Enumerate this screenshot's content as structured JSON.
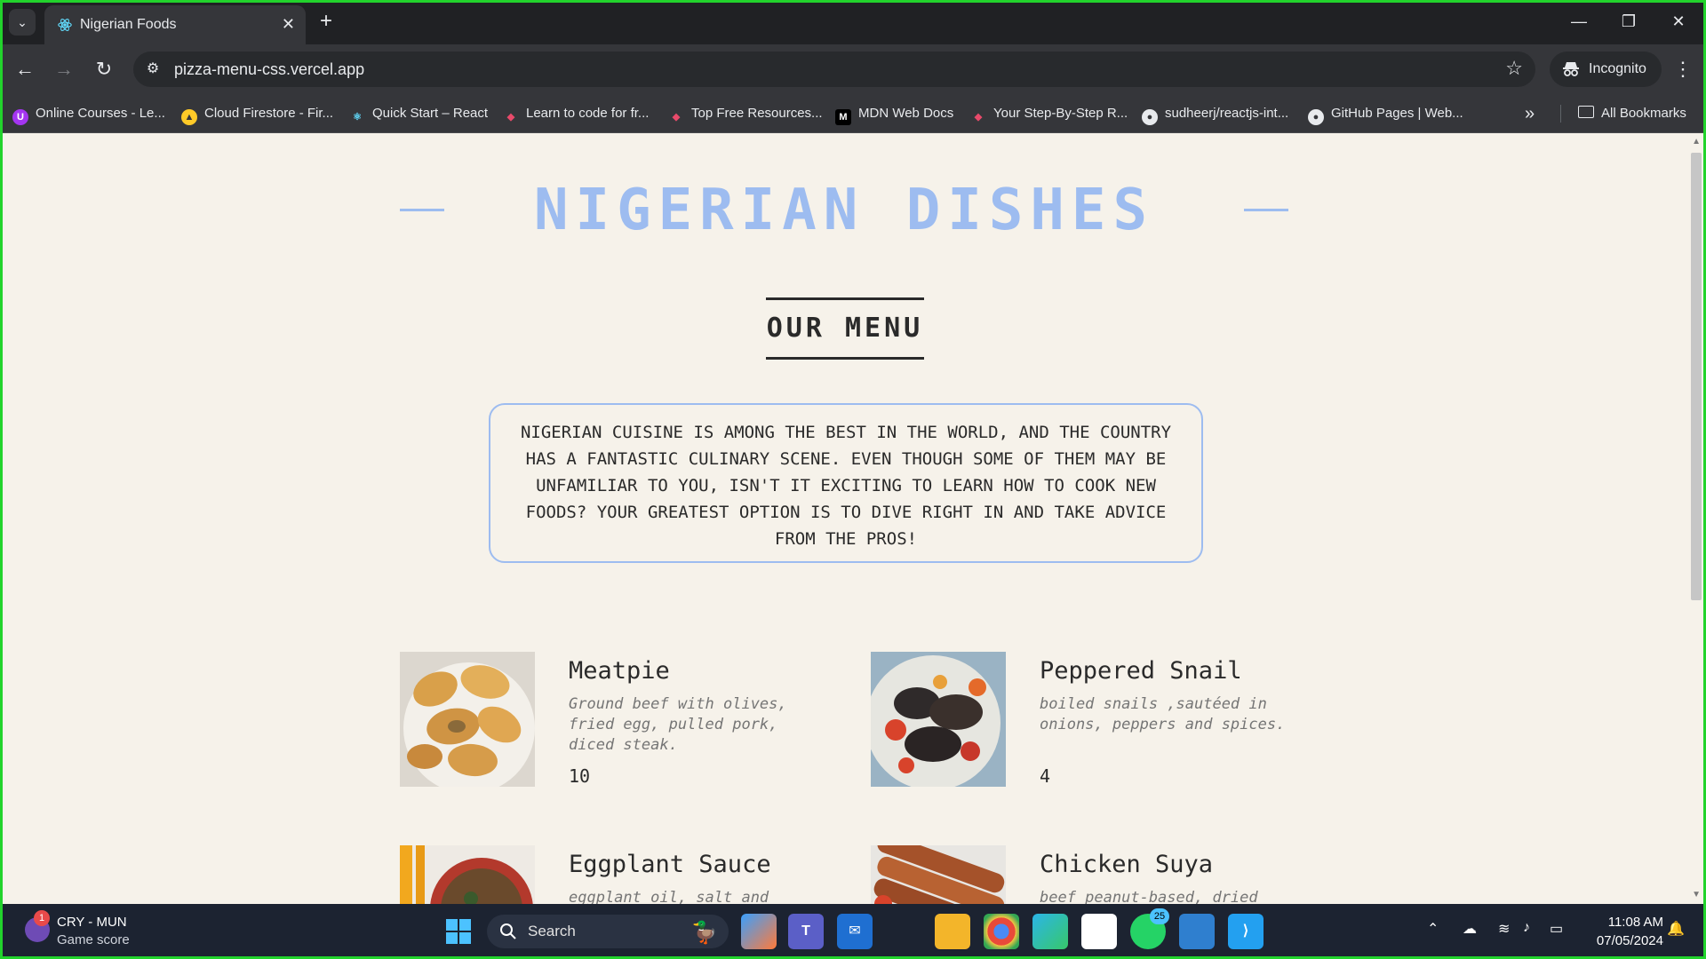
{
  "browser": {
    "tab_title": "Nigerian Foods",
    "url": "pizza-menu-css.vercel.app",
    "incognito_label": "Incognito"
  },
  "bookmarks": [
    {
      "label": "Online Courses - Le...",
      "icon": "udemy-icon",
      "color": "#a435f0"
    },
    {
      "label": "Cloud Firestore - Fir...",
      "icon": "firebase-icon",
      "color": "#ffca28"
    },
    {
      "label": "Quick Start – React",
      "icon": "react-icon",
      "color": "#61dafb"
    },
    {
      "label": "Learn to code for fr...",
      "icon": "scrimba-icon",
      "color": "#e84a6a"
    },
    {
      "label": "Top Free Resources...",
      "icon": "scrimba-icon",
      "color": "#e84a6a"
    },
    {
      "label": "MDN Web Docs",
      "icon": "mdn-icon",
      "color": "#ffffff"
    },
    {
      "label": "Your Step-By-Step R...",
      "icon": "scrimba-icon",
      "color": "#e84a6a"
    },
    {
      "label": "sudheerj/reactjs-int...",
      "icon": "github-icon",
      "color": "#ffffff"
    },
    {
      "label": "GitHub Pages | Web...",
      "icon": "github-icon",
      "color": "#ffffff"
    }
  ],
  "all_bookmarks_label": "All Bookmarks",
  "page": {
    "title": "NIGERIAN DISHES",
    "menu_heading": "OUR MENU",
    "intro": "NIGERIAN CUISINE IS AMONG THE BEST IN THE WORLD, AND THE COUNTRY HAS A FANTASTIC CULINARY SCENE. EVEN THOUGH SOME OF THEM MAY BE UNFAMILIAR TO YOU, ISN'T IT EXCITING TO LEARN HOW TO COOK NEW FOODS? YOUR GREATEST OPTION IS TO DIVE RIGHT IN AND TAKE ADVICE FROM THE PROS!",
    "accent_color": "#9dbcf0",
    "background_color": "#f6f2ea",
    "items": [
      {
        "name": "Meatpie",
        "description": "Ground beef with olives, fried egg, pulled pork, diced steak.",
        "price": "10"
      },
      {
        "name": "Peppered Snail",
        "description": "boiled snails ,sautéed in onions, peppers and spices.",
        "price": "4"
      },
      {
        "name": "Eggplant Sauce",
        "description": "eggplant oil, salt and",
        "price": ""
      },
      {
        "name": "Chicken Suya",
        "description": "beef peanut-based, dried",
        "price": ""
      }
    ]
  },
  "taskbar": {
    "widget_title": "CRY - MUN",
    "widget_subtitle": "Game score",
    "widget_badge": "1",
    "search_placeholder": "Search",
    "whatsapp_badge": "25",
    "time": "11:08 AM",
    "date": "07/05/2024"
  }
}
